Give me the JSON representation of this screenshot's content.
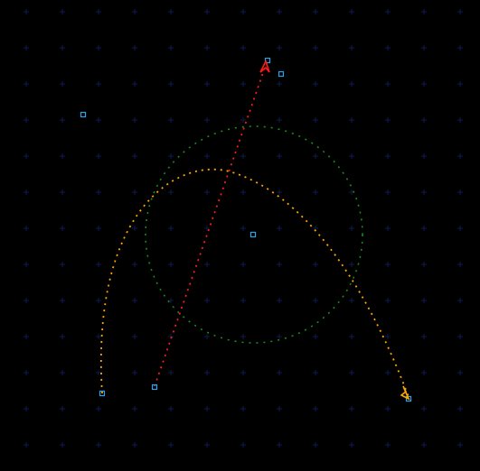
{
  "scene": {
    "background": "#000000",
    "grid_color": "#0e1a4a",
    "grid_mark": "plus-marker"
  },
  "paths": [
    {
      "id": "red-trajectory",
      "color": "#ff1a1a",
      "style": "dotted",
      "start_icon": "square-node-icon",
      "end_icon": "arrowhead-icon"
    },
    {
      "id": "orange-trajectory",
      "color": "#ffa500",
      "style": "dotted",
      "start_icon": "square-node-icon",
      "end_icon": "arrowhead-icon"
    },
    {
      "id": "green-circle",
      "color": "#1a8c1a",
      "style": "dotted",
      "shape": "circle"
    }
  ],
  "node_color": "#2aa4e8",
  "node_icon": "square-node-icon"
}
